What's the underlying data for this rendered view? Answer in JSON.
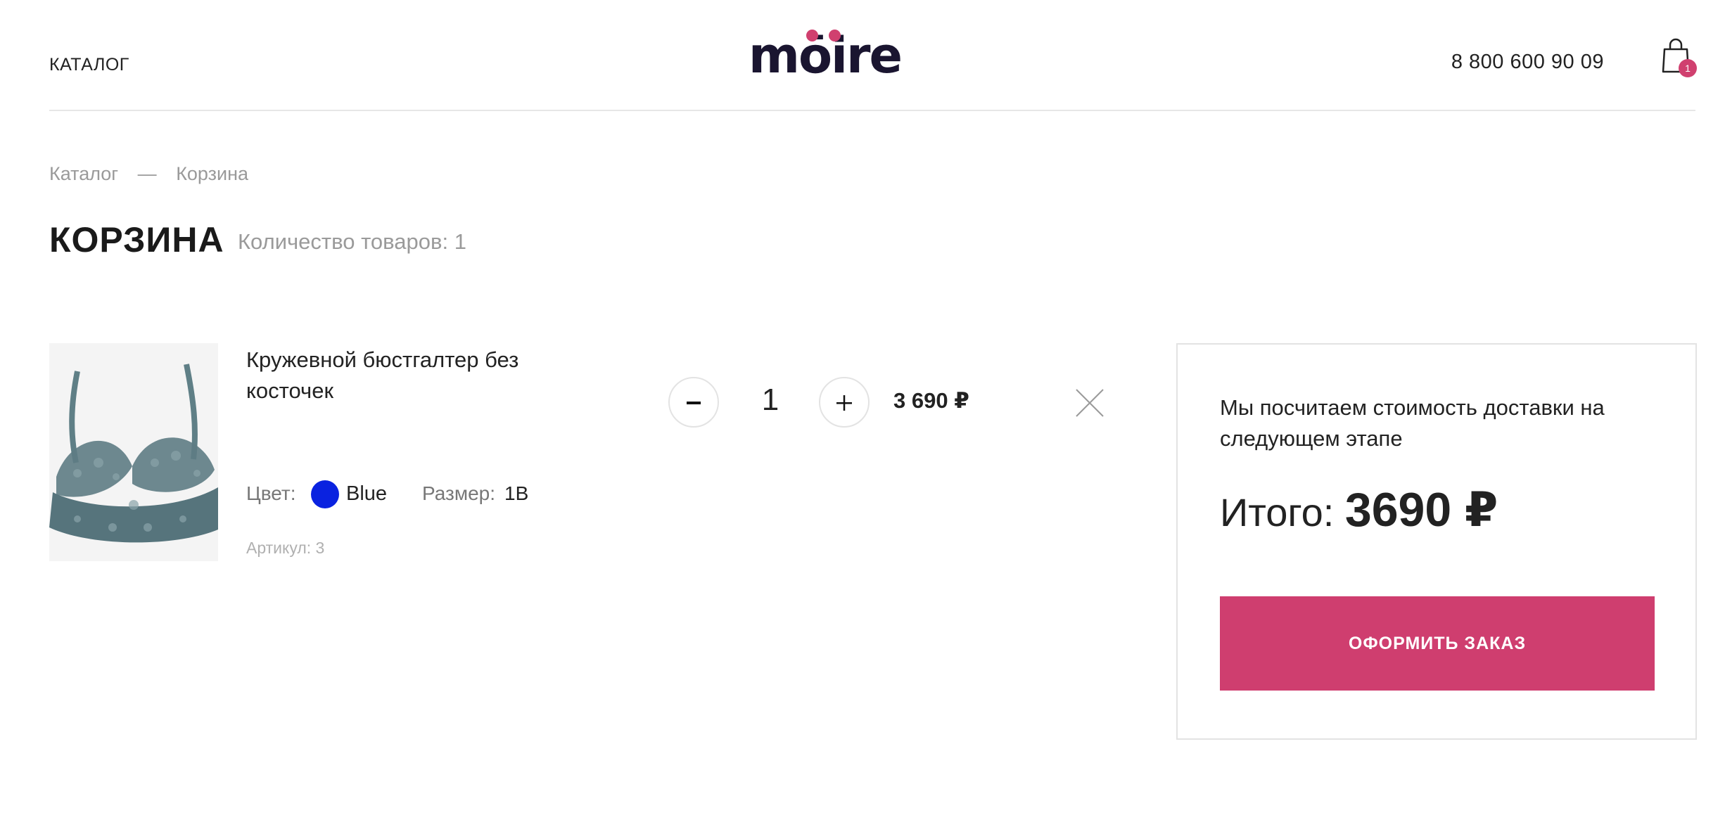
{
  "header": {
    "catalog_label": "КАТАЛОГ",
    "logo_text": "mōire",
    "phone": "8 800 600 90 09",
    "cart_count": "1"
  },
  "breadcrumb": {
    "items": [
      "Каталог",
      "Корзина"
    ],
    "separator": "—"
  },
  "page": {
    "title": "КОРЗИНА",
    "items_count": "Количество товаров: 1"
  },
  "cart_items": [
    {
      "name": "Кружевной бюстгалтер без косточек",
      "color_label": "Цвет:",
      "color_value": "Blue",
      "color_hex": "#0a22e0",
      "size_label": "Размер:",
      "size_value": "1B",
      "article": "Артикул: 3",
      "quantity": "1",
      "minus_label": "−",
      "plus_label": "+",
      "price": "3 690 ₽"
    }
  ],
  "summary": {
    "delivery_note": "Мы посчитаем стоимость доставки на следующем этапе",
    "total_label": "Итого: ",
    "total_value": "3690 ₽",
    "checkout_label": "ОФОРМИТЬ ЗАКАЗ"
  },
  "colors": {
    "accent": "#cf3e6f",
    "logo_dark": "#1a1530",
    "border": "#e3e3e3",
    "muted_text": "#9a9a9a"
  },
  "icons": [
    "cart-icon",
    "close-icon",
    "minus-icon",
    "plus-icon"
  ]
}
